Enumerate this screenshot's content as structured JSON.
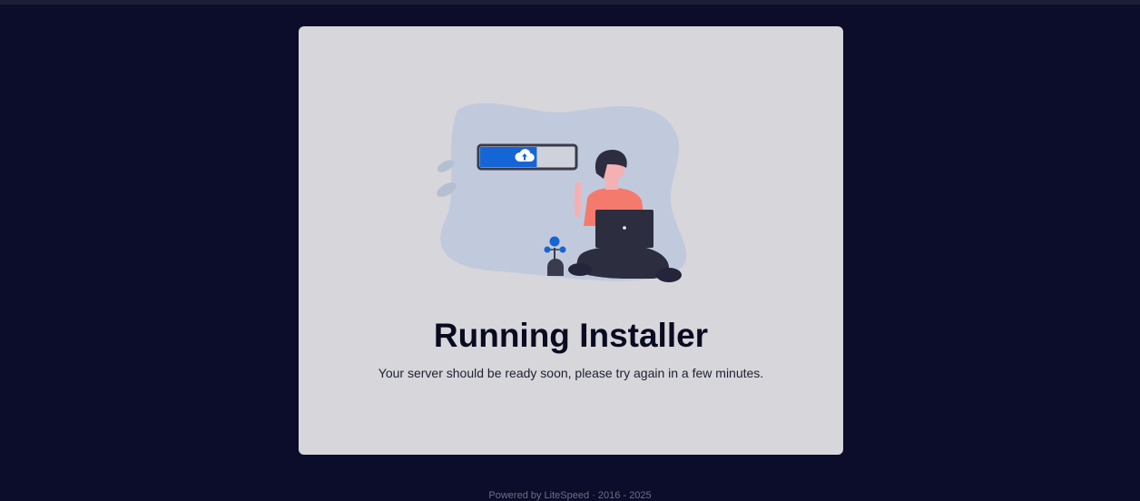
{
  "title": "Running Installer",
  "message": "Your server should be ready soon, please try again in a few minutes.",
  "footer": "Powered by LiteSpeed · 2016 - 2025",
  "upload_progress": 0.6,
  "colors": {
    "background": "#0b0d2a",
    "card": "#d7d6db",
    "accent": "#1466d6",
    "shirt": "#f57a6e"
  },
  "icons": {
    "upload": "cloud-upload-icon"
  }
}
